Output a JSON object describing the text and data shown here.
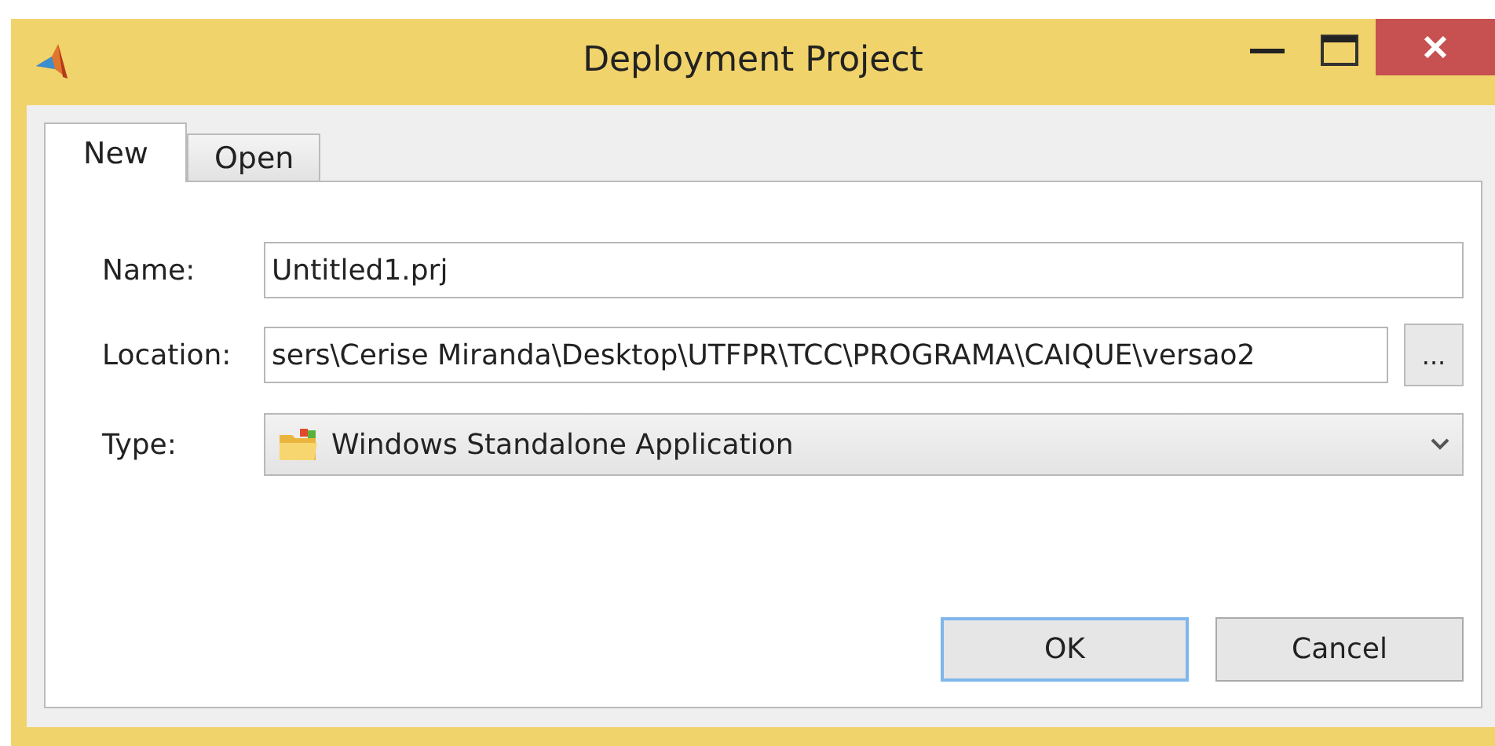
{
  "window": {
    "title": "Deployment Project"
  },
  "tabs": [
    {
      "label": "New",
      "selected": true
    },
    {
      "label": "Open",
      "selected": false
    }
  ],
  "form": {
    "name": {
      "label": "Name:",
      "value": "Untitled1.prj"
    },
    "location": {
      "label": "Location:",
      "value": "sers\\Cerise Miranda\\Desktop\\UTFPR\\TCC\\PROGRAMA\\CAIQUE\\versao2",
      "browse": "..."
    },
    "type": {
      "label": "Type:",
      "value": "Windows Standalone Application"
    }
  },
  "buttons": [
    {
      "label": "OK",
      "default": true
    },
    {
      "label": "Cancel",
      "default": false
    }
  ]
}
